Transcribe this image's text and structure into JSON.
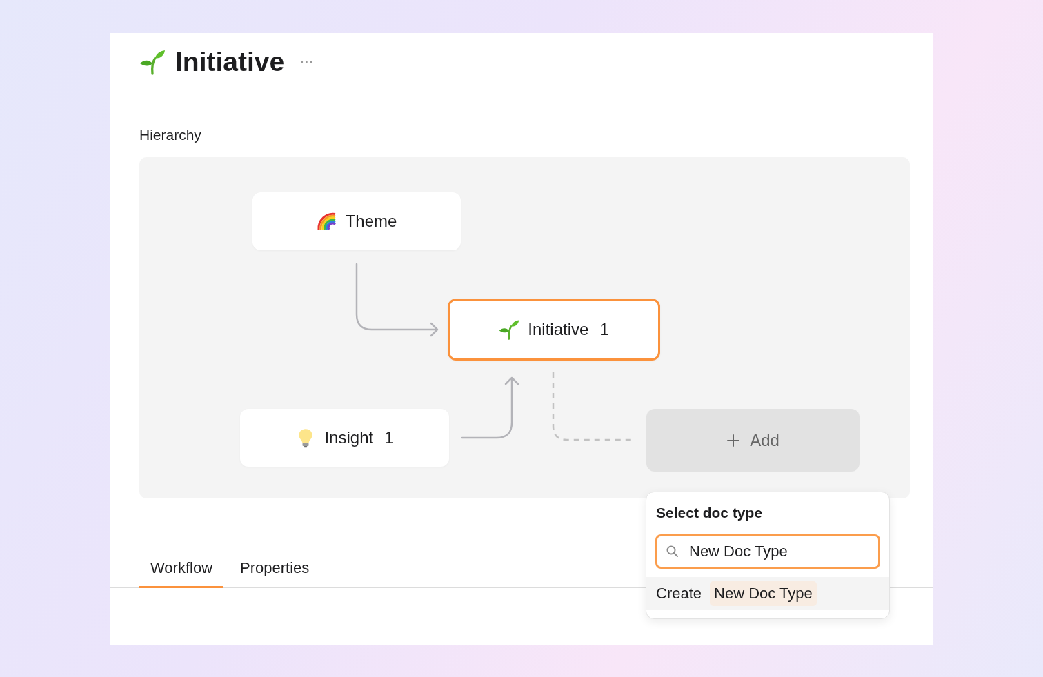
{
  "header": {
    "kind": "sprout",
    "title": "Initiative"
  },
  "hierarchy": {
    "label": "Hierarchy",
    "nodes": [
      {
        "kind": "rainbow",
        "label": "Theme",
        "selected": false
      },
      {
        "kind": "sprout",
        "label": "Initiative",
        "count": "1",
        "selected": true
      },
      {
        "kind": "bulb",
        "label": "Insight",
        "count": "1",
        "selected": false
      }
    ],
    "add_button": {
      "label": "Add"
    }
  },
  "tabs": [
    {
      "label": "Workflow",
      "selected": true
    },
    {
      "label": "Properties",
      "selected": false
    }
  ],
  "popup": {
    "title": "Select doc type",
    "search": {
      "value": "New Doc Type"
    },
    "option": {
      "action": "Create",
      "name": "New Doc Type"
    }
  }
}
